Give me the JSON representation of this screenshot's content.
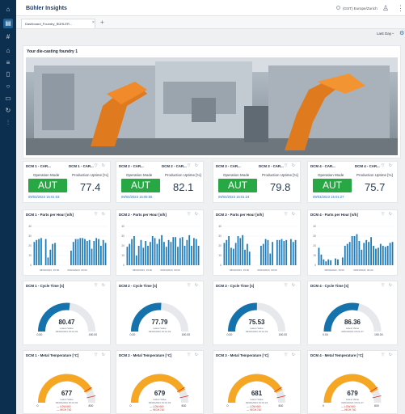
{
  "app": {
    "brand": "Bühler Insights",
    "timezone": "(GST) Europe/Zurich"
  },
  "tab": {
    "label": "Dashboard_Foundry_BÜHLER..."
  },
  "toolbar": {
    "range": "Last Day"
  },
  "image_panel": {
    "title": "Your die-casting foundry 1"
  },
  "machines": [
    {
      "mode_title": "DCM 1 - CAR...",
      "uptime_title": "DCM 1 - CAR...",
      "mode_label": "Operation Mode",
      "mode_value": "AUT",
      "mode_time": "09/03/2023 15:01:03",
      "uptime_label": "Production Uptime [%]",
      "uptime_value": "77.4",
      "parts_title": "DCM 1 - Parts per Hour [n/h]",
      "cycle_title": "DCM 1 - Cycle Time [s]",
      "temp_title": "DCM 1 - Metal Temperature [°C]"
    },
    {
      "mode_title": "DCM 2 - CAR...",
      "uptime_title": "DCM 2 - CAR...",
      "mode_label": "Operation Mode",
      "mode_value": "AUT",
      "mode_time": "09/03/2023 15:05:55",
      "uptime_label": "Production Uptime [%]",
      "uptime_value": "82.1",
      "parts_title": "DCM 2 - Parts per Hour [n/h]",
      "cycle_title": "DCM 2 - Cycle Time [s]",
      "temp_title": "DCM 2 - Metal Temperature [°C]"
    },
    {
      "mode_title": "DCM 3 - CAR...",
      "uptime_title": "DCM 3 - CAR...",
      "mode_label": "Operation Mode",
      "mode_value": "AUT",
      "mode_time": "09/03/2023 15:01:24",
      "uptime_label": "Production Uptime [%]",
      "uptime_value": "79.8",
      "parts_title": "DCM 3 - Parts per Hour [n/h]",
      "cycle_title": "DCM 3 - Cycle Time [s]",
      "temp_title": "DCM 3 - Metal Temperature [°C]"
    },
    {
      "mode_title": "DCM 4 - CAR...",
      "uptime_title": "DCM 4 - CAR...",
      "mode_label": "Operation Mode",
      "mode_value": "AUT",
      "mode_time": "09/03/2023 15:01:27",
      "uptime_label": "Production Uptime [%]",
      "uptime_value": "75.7",
      "parts_title": "DCM 4 - Parts per Hour [n/h]",
      "cycle_title": "DCM 4 - Cycle Time [s]",
      "temp_title": "DCM 4 - Metal Temperature [°C]"
    }
  ],
  "colors": {
    "bar": "#1f7cb8",
    "cycle_gauge": "#1473ad",
    "temp_gauge": "#f5a623",
    "aut": "#27a844",
    "limit": "#d93025",
    "gauge_track": "#e6e8eb"
  },
  "chart_data": [
    {
      "type": "bar",
      "title": "DCM 1 - Parts per Hour [n/h]",
      "ylim": [
        0,
        40
      ],
      "yticks": [
        0,
        10,
        20,
        30,
        40
      ],
      "xticks": [
        "08/03/2023, 15:00",
        "09/03/2023, 00:00"
      ],
      "values": [
        24,
        26,
        27,
        28,
        0,
        27,
        8,
        16,
        22,
        23,
        0,
        0,
        0,
        0,
        0,
        0,
        15,
        24,
        27,
        27,
        28,
        28,
        27,
        25,
        26,
        17,
        25,
        28,
        27,
        20,
        26,
        23
      ]
    },
    {
      "type": "bar",
      "title": "DCM 2 - Parts per Hour [n/h]",
      "ylim": [
        0,
        40
      ],
      "yticks": [
        0,
        10,
        20,
        30,
        40
      ],
      "xticks": [
        "08/03/2023, 15:00",
        "09/03/2023, 00:00"
      ],
      "values": [
        19,
        22,
        27,
        30,
        10,
        20,
        26,
        18,
        25,
        20,
        24,
        30,
        28,
        22,
        27,
        31,
        24,
        19,
        26,
        24,
        29,
        29,
        19,
        28,
        29,
        20,
        26,
        31,
        20,
        28,
        27,
        20
      ]
    },
    {
      "type": "bar",
      "title": "DCM 3 - Parts per Hour [n/h]",
      "ylim": [
        0,
        40
      ],
      "yticks": [
        0,
        10,
        20,
        30,
        40
      ],
      "xticks": [
        "08/03/2023, 15:00",
        "09/03/2023, 00:00"
      ],
      "values": [
        23,
        26,
        30,
        18,
        17,
        23,
        30,
        28,
        31,
        16,
        22,
        14,
        0,
        0,
        0,
        0,
        20,
        22,
        27,
        26,
        12,
        24,
        0,
        26,
        26,
        27,
        25,
        26,
        0,
        27,
        24,
        26
      ]
    },
    {
      "type": "bar",
      "title": "DCM 4 - Parts per Hour [n/h]",
      "ylim": [
        0,
        40
      ],
      "yticks": [
        0,
        10,
        20,
        30,
        40
      ],
      "xticks": [
        "08/03/2023, 15:00",
        "09/03/2023, 00:00"
      ],
      "values": [
        18,
        11,
        6,
        4,
        6,
        5,
        0,
        7,
        6,
        0,
        8,
        20,
        22,
        24,
        30,
        30,
        32,
        25,
        16,
        23,
        26,
        24,
        29,
        20,
        17,
        18,
        22,
        20,
        19,
        20,
        23,
        24
      ]
    }
  ],
  "cycle_gauges": [
    {
      "value": "80.47",
      "min": "0.00",
      "max": "150.00",
      "sub1": "Latest Value",
      "sub2": "09/03/2023 15:01:03"
    },
    {
      "value": "77.79",
      "min": "0.00",
      "max": "150.00",
      "sub1": "Latest Value",
      "sub2": "09/03/2023 15:01:03"
    },
    {
      "value": "75.53",
      "min": "0.00",
      "max": "150.00",
      "sub1": "Latest Value",
      "sub2": "09/03/2023 15:01:03"
    },
    {
      "value": "86.36",
      "min": "0.00",
      "max": "150.00",
      "sub1": "Latest Value",
      "sub2": "09/03/2023 15:01:27"
    }
  ],
  "temp_gauges": [
    {
      "value": "677",
      "min": "0",
      "max": "800",
      "sub1": "Latest Value",
      "sub2": "09/03/2023 15:01:03",
      "low": "— LOW 660",
      "high": "— HIGH 740"
    },
    {
      "value": "679",
      "min": "0",
      "max": "800",
      "sub1": "Latest Value",
      "sub2": "09/03/2023 15:01:03",
      "low": "— LOW 660",
      "high": "— HIGH 740"
    },
    {
      "value": "681",
      "min": "0",
      "max": "800",
      "sub1": "Latest Value",
      "sub2": "09/03/2023 15:01:24",
      "low": "— LOW 660",
      "high": "— HIGH 740"
    },
    {
      "value": "679",
      "min": "0",
      "max": "800",
      "sub1": "Latest Value",
      "sub2": "09/03/2023 15:01:27",
      "low": "— LOW 660",
      "high": "— HIGH 740"
    }
  ]
}
